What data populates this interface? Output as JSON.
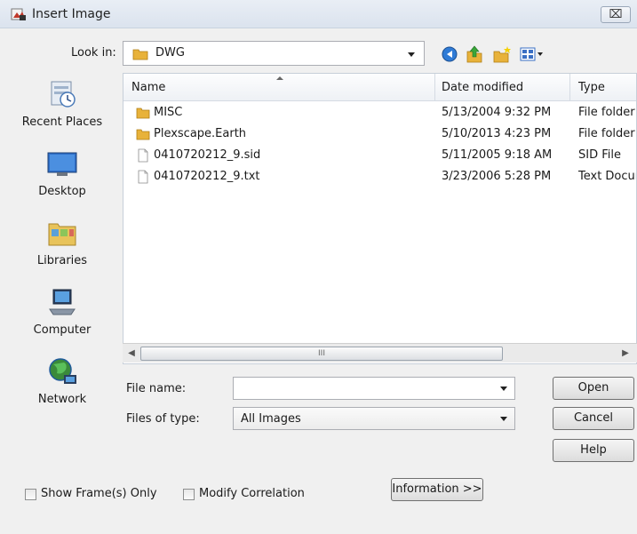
{
  "window": {
    "title": "Insert Image",
    "close_label": "⌧"
  },
  "lookin": {
    "label": "Look in:",
    "value": "DWG"
  },
  "places": [
    {
      "label": "Recent Places",
      "icon": "recent-places-icon"
    },
    {
      "label": "Desktop",
      "icon": "desktop-icon"
    },
    {
      "label": "Libraries",
      "icon": "libraries-icon"
    },
    {
      "label": "Computer",
      "icon": "computer-icon"
    },
    {
      "label": "Network",
      "icon": "network-icon"
    }
  ],
  "filelist": {
    "columns": [
      "Name",
      "Date modified",
      "Type"
    ],
    "rows": [
      {
        "name": "MISC",
        "date": "5/13/2004 9:32 PM",
        "type": "File folder",
        "icon": "folder-icon"
      },
      {
        "name": "Plexscape.Earth",
        "date": "5/10/2013 4:23 PM",
        "type": "File folder",
        "icon": "folder-icon"
      },
      {
        "name": "0410720212_9.sid",
        "date": "5/11/2005 9:18 AM",
        "type": "SID File",
        "icon": "file-icon"
      },
      {
        "name": "0410720212_9.txt",
        "date": "3/23/2006 5:28 PM",
        "type": "Text Document",
        "icon": "file-icon"
      }
    ]
  },
  "scrollbar": {
    "grip": "III"
  },
  "form": {
    "filename_label": "File name:",
    "filename_value": "",
    "filetype_label": "Files of type:",
    "filetype_value": "All Images"
  },
  "buttons": {
    "open": "Open",
    "cancel": "Cancel",
    "help": "Help",
    "information": "Information >>"
  },
  "options": {
    "show_frames": "Show Frame(s) Only",
    "modify_correlation": "Modify Correlation"
  },
  "colors": {
    "folder": "#e8b23a",
    "accent": "#3a6fc4"
  }
}
